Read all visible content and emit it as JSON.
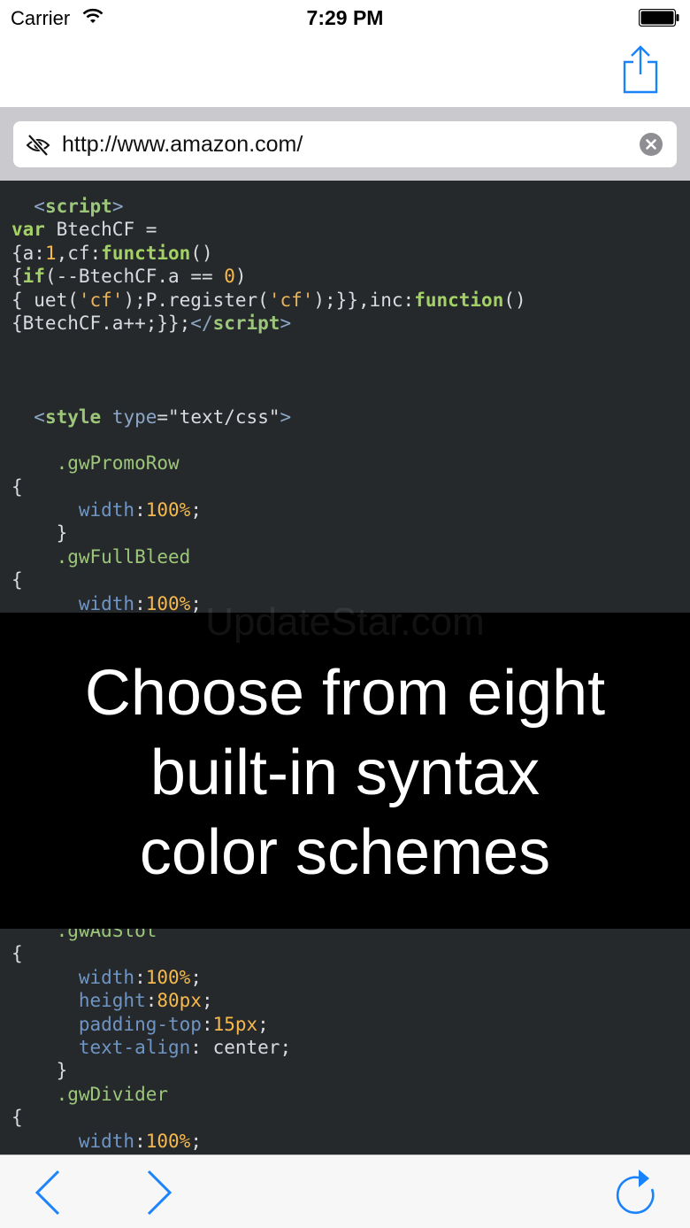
{
  "status_bar": {
    "carrier": "Carrier",
    "time": "7:29 PM"
  },
  "url_bar": {
    "url": "http://www.amazon.com/"
  },
  "code_top": [
    [
      [
        "",
        "  "
      ],
      [
        "tag",
        "<"
      ],
      [
        "tagname",
        "script"
      ],
      [
        "tag",
        ">"
      ]
    ],
    [
      [
        "kw",
        "var"
      ],
      [
        "",
        " BtechCF ="
      ]
    ],
    [
      [
        "",
        "{a:"
      ],
      [
        "num",
        "1"
      ],
      [
        "",
        ",cf:"
      ],
      [
        "kw",
        "function"
      ],
      [
        "",
        "()"
      ]
    ],
    [
      [
        "",
        "{"
      ],
      [
        "kw",
        "if"
      ],
      [
        "",
        "(--BtechCF.a == "
      ],
      [
        "num",
        "0"
      ],
      [
        "",
        ")"
      ]
    ],
    [
      [
        "",
        "{ uet("
      ],
      [
        "str",
        "'cf'"
      ],
      [
        "",
        ");P.register("
      ],
      [
        "str",
        "'cf'"
      ],
      [
        "",
        ");}},inc:"
      ],
      [
        "kw",
        "function"
      ],
      [
        "",
        "()"
      ]
    ],
    [
      [
        "",
        "{BtechCF.a++;}};"
      ],
      [
        "tag",
        "</"
      ],
      [
        "tagname",
        "script"
      ],
      [
        "tag",
        ">"
      ]
    ],
    [
      [
        "",
        ""
      ]
    ],
    [
      [
        "",
        ""
      ]
    ],
    [
      [
        "",
        ""
      ]
    ],
    [
      [
        "",
        "  "
      ],
      [
        "tag",
        "<"
      ],
      [
        "tagname",
        "style"
      ],
      [
        "",
        " "
      ],
      [
        "attr",
        "type"
      ],
      [
        "",
        "=\"text/css\""
      ],
      [
        "tag",
        ">"
      ]
    ],
    [
      [
        "",
        ""
      ]
    ],
    [
      [
        "",
        "    "
      ],
      [
        "sel",
        ".gwPromoRow"
      ]
    ],
    [
      [
        "",
        "{"
      ]
    ],
    [
      [
        "",
        "      "
      ],
      [
        "prop",
        "width"
      ],
      [
        "",
        ":"
      ],
      [
        "num",
        "100%"
      ],
      [
        "",
        ";"
      ]
    ],
    [
      [
        "",
        "    }"
      ]
    ],
    [
      [
        "",
        "    "
      ],
      [
        "sel",
        ".gwFullBleed"
      ]
    ],
    [
      [
        "",
        "{"
      ]
    ],
    [
      [
        "",
        "      "
      ],
      [
        "prop",
        "width"
      ],
      [
        "",
        ":"
      ],
      [
        "num",
        "100%"
      ],
      [
        "",
        ";"
      ]
    ]
  ],
  "code_bottom": [
    [
      [
        "",
        "    "
      ],
      [
        "sel",
        ".gwAdSlot"
      ]
    ],
    [
      [
        "",
        "{"
      ]
    ],
    [
      [
        "",
        "      "
      ],
      [
        "prop",
        "width"
      ],
      [
        "",
        ":"
      ],
      [
        "num",
        "100%"
      ],
      [
        "",
        ";"
      ]
    ],
    [
      [
        "",
        "      "
      ],
      [
        "prop",
        "height"
      ],
      [
        "",
        ":"
      ],
      [
        "num",
        "80px"
      ],
      [
        "",
        ";"
      ]
    ],
    [
      [
        "",
        "      "
      ],
      [
        "prop",
        "padding-top"
      ],
      [
        "",
        ":"
      ],
      [
        "num",
        "15px"
      ],
      [
        "",
        ";"
      ]
    ],
    [
      [
        "",
        "      "
      ],
      [
        "prop",
        "text-align"
      ],
      [
        "",
        ": center;"
      ]
    ],
    [
      [
        "",
        "    }"
      ]
    ],
    [
      [
        "",
        "    "
      ],
      [
        "sel",
        ".gwDivider"
      ]
    ],
    [
      [
        "",
        "{"
      ]
    ],
    [
      [
        "",
        "      "
      ],
      [
        "prop",
        "width"
      ],
      [
        "",
        ":"
      ],
      [
        "num",
        "100%"
      ],
      [
        "",
        ";"
      ]
    ]
  ],
  "banner": {
    "watermark": "UpdateStar.com",
    "line1": "Choose from eight",
    "line2": "built-in syntax",
    "line3": "color schemes"
  },
  "colors": {
    "accent": "#1a82fb",
    "code_background": "#26292c",
    "keyword": "#a3d165",
    "number": "#f7b94c",
    "property": "#6e95c4"
  },
  "icons": {
    "share": "share-icon",
    "eye": "eye-slash-icon",
    "clear": "clear-icon",
    "back": "chevron-left-icon",
    "forward": "chevron-right-icon",
    "reload": "reload-icon"
  }
}
